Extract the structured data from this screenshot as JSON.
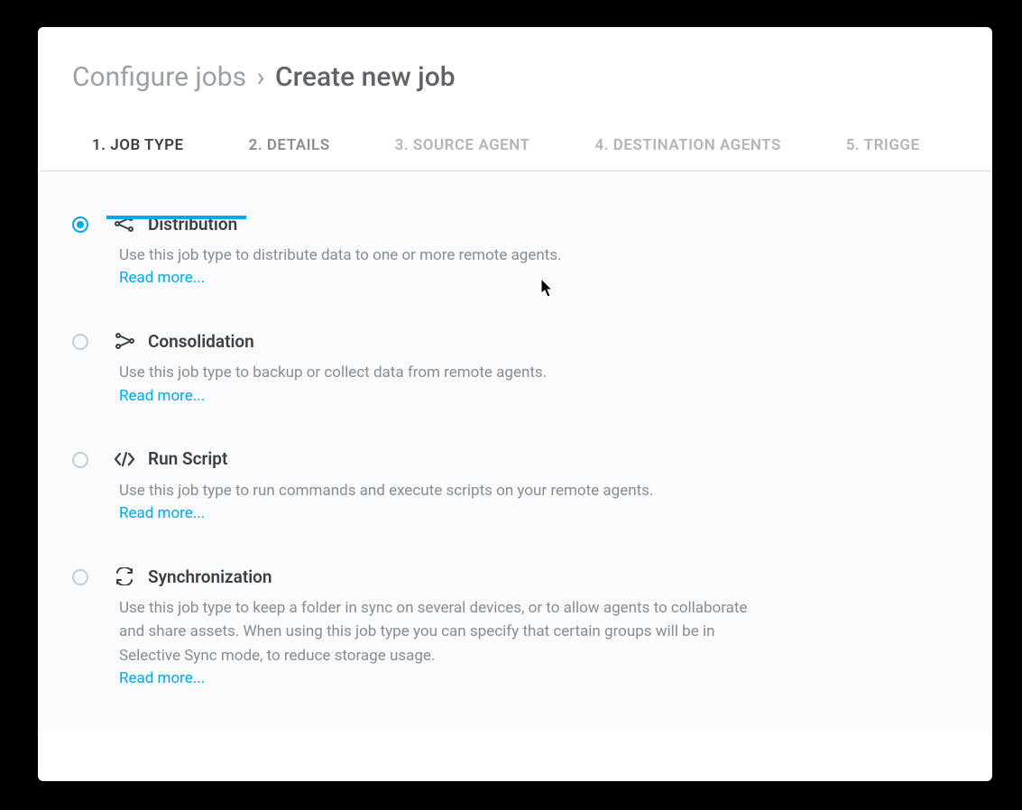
{
  "breadcrumb": {
    "parent": "Configure jobs",
    "separator": "›",
    "current": "Create new job"
  },
  "tabs": [
    {
      "label": "1. JOB TYPE",
      "state": "active"
    },
    {
      "label": "2. DETAILS",
      "state": "mid"
    },
    {
      "label": "3. SOURCE AGENT",
      "state": "inactive"
    },
    {
      "label": "4. DESTINATION AGENTS",
      "state": "inactive"
    },
    {
      "label": "5. TRIGGE",
      "state": "inactive"
    }
  ],
  "options": [
    {
      "id": "distribution",
      "title": "Distribution",
      "description": "Use this job type to distribute data to one or more remote agents.",
      "read_more": "Read more...",
      "selected": true,
      "icon": "distribute-icon"
    },
    {
      "id": "consolidation",
      "title": "Consolidation",
      "description": "Use this job type to backup or collect data from remote agents.",
      "read_more": "Read more...",
      "selected": false,
      "icon": "consolidate-icon"
    },
    {
      "id": "run-script",
      "title": "Run Script",
      "description": "Use this job type to run commands and execute scripts on your remote agents.",
      "read_more": "Read more...",
      "selected": false,
      "icon": "script-icon"
    },
    {
      "id": "synchronization",
      "title": "Synchronization",
      "description": "Use this job type to keep a folder in sync on several devices, or to allow agents to collaborate and share assets. When using this job type you can specify that certain groups will be in Selective Sync mode, to reduce storage usage.",
      "read_more": "Read more...",
      "selected": false,
      "icon": "sync-icon"
    }
  ]
}
